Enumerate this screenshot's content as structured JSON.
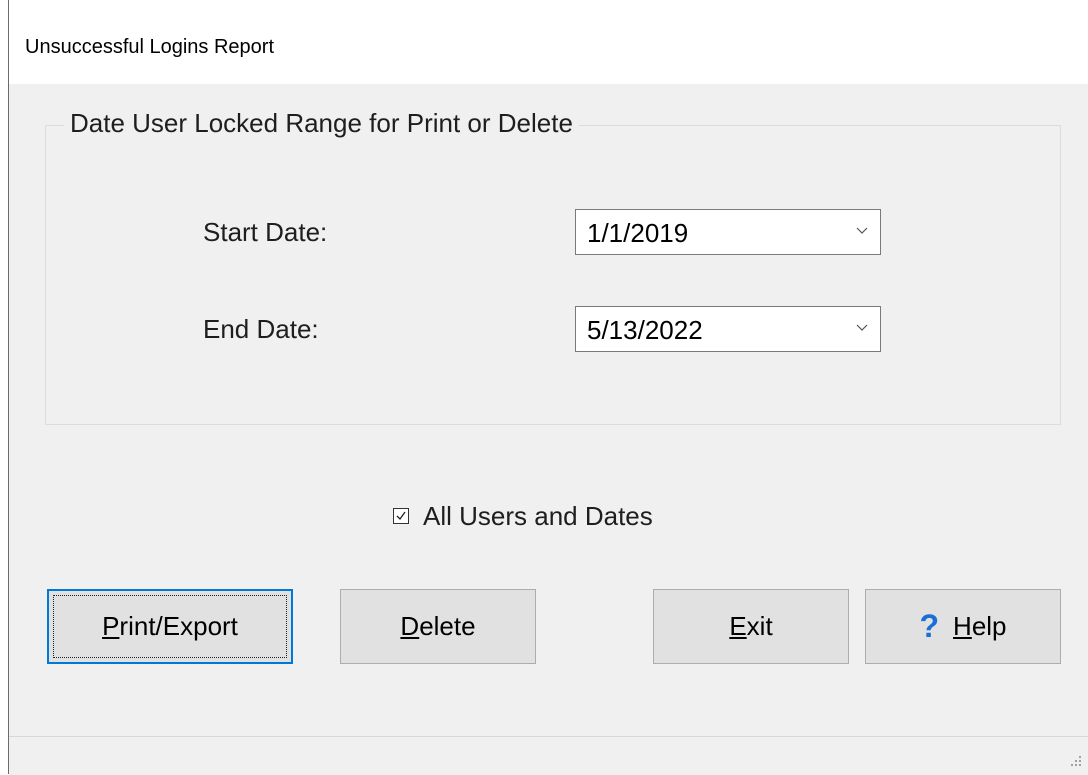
{
  "window": {
    "title": "Unsuccessful Logins Report"
  },
  "group": {
    "legend": "Date User Locked Range for Print or Delete",
    "start_date_label": "Start Date:",
    "start_date_value": "1/1/2019",
    "end_date_label": "End Date:",
    "end_date_value": "5/13/2022"
  },
  "options": {
    "all_users_label": "All Users and Dates",
    "all_users_checked": true
  },
  "buttons": {
    "print_export": {
      "mnemonic": "P",
      "rest": "rint/Export"
    },
    "delete": {
      "mnemonic": "D",
      "rest": "elete"
    },
    "exit": {
      "mnemonic": "E",
      "rest": "xit"
    },
    "help": {
      "icon_glyph": "?",
      "mnemonic": "H",
      "rest": "elp"
    }
  },
  "icons": {
    "dropdown": "chevron-down-icon",
    "help": "question-mark-icon",
    "checkbox": "checkmark-icon",
    "grip": "resize-grip-icon"
  },
  "colors": {
    "accent": "#0078d7",
    "help_icon": "#1a6fd6",
    "window_bg": "#f0f0f0",
    "button_bg": "#e1e1e1"
  }
}
